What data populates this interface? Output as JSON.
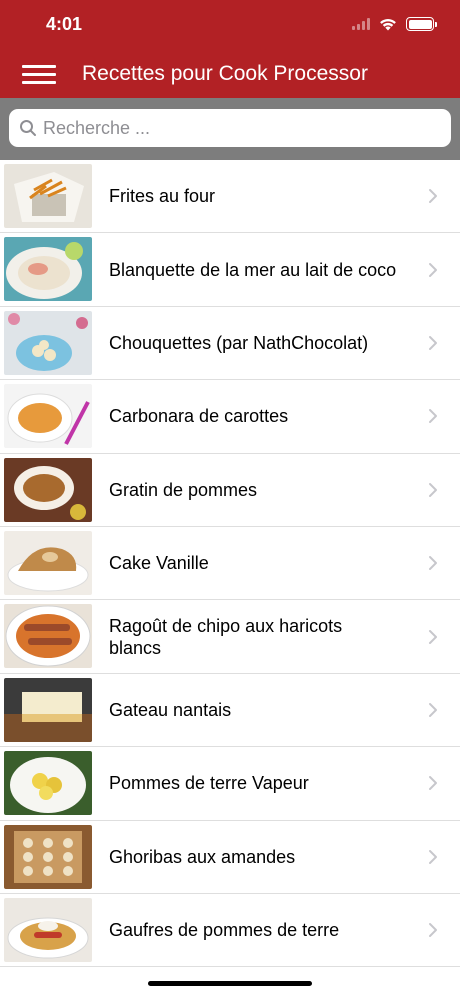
{
  "status_bar": {
    "time": "4:01"
  },
  "nav": {
    "title": "Recettes pour Cook Processor",
    "menu_icon": "hamburger-menu-icon"
  },
  "search": {
    "placeholder": "Recherche ..."
  },
  "colors": {
    "header": "#b22125",
    "search_bg": "#7d7d7d",
    "separator": "#dedede",
    "chevron": "#c7c7cc"
  },
  "recipes": [
    {
      "title": "Frites au four"
    },
    {
      "title": "Blanquette de la mer au lait de coco"
    },
    {
      "title": "Chouquettes (par NathChocolat)"
    },
    {
      "title": "Carbonara de carottes"
    },
    {
      "title": "Gratin de pommes"
    },
    {
      "title": "Cake Vanille"
    },
    {
      "title": "Ragoût de chipo aux haricots blancs"
    },
    {
      "title": "Gateau nantais"
    },
    {
      "title": "Pommes de terre Vapeur"
    },
    {
      "title": "Ghoribas aux amandes"
    },
    {
      "title": "Gaufres de pommes de terre"
    }
  ]
}
